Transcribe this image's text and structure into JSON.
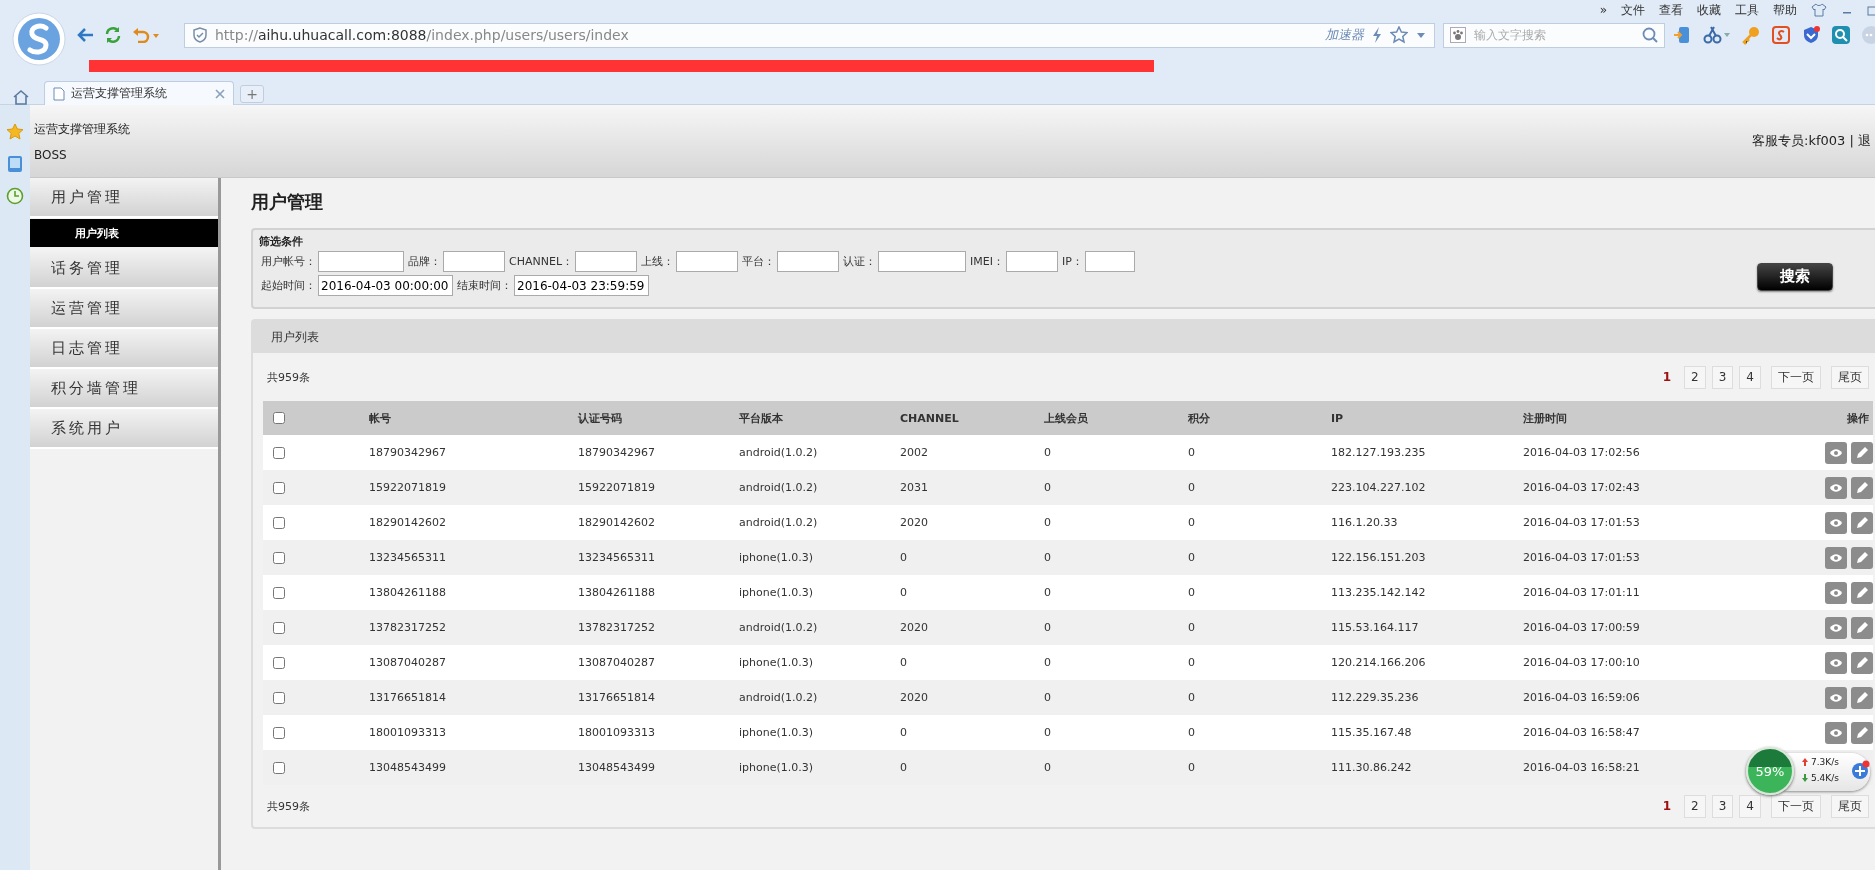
{
  "browser": {
    "menu": [
      "»",
      "文件",
      "查看",
      "收藏",
      "工具",
      "帮助"
    ],
    "url": {
      "scheme": "http://",
      "host": "aihu.uhuacall.com:8088",
      "path": "/index.php/users/users/index"
    },
    "accelerator": "加速器",
    "search_placeholder": "输入文字搜索",
    "tabs": [
      {
        "title": "运营支撑管理系统",
        "selected": true
      }
    ],
    "new_tab": "+"
  },
  "header": {
    "system_name": "运营支撑管理系统",
    "subtitle": "BOSS",
    "user_info": "客服专员:kf003 | 退"
  },
  "sidebar": {
    "items": [
      {
        "label": "用户管理",
        "children": [
          {
            "label": "用户列表",
            "selected": true
          }
        ]
      },
      {
        "label": "话务管理"
      },
      {
        "label": "运营管理"
      },
      {
        "label": "日志管理"
      },
      {
        "label": "积分墙管理"
      },
      {
        "label": "系统用户"
      }
    ]
  },
  "page_title": "用户管理",
  "filter": {
    "title": "筛选条件",
    "search_fields": [
      {
        "label": "用户帐号："
      },
      {
        "label": "品牌："
      },
      {
        "label": "CHANNEL："
      },
      {
        "label": "上线："
      },
      {
        "label": "平台："
      },
      {
        "label": "认证："
      },
      {
        "label": "IMEI："
      },
      {
        "label": "IP："
      }
    ],
    "time_fields": [
      {
        "label": "起始时间：",
        "value": "2016-04-03 00:00:00"
      },
      {
        "label": "结束时间：",
        "value": "2016-04-03 23:59:59"
      }
    ],
    "search_button": "搜索"
  },
  "user_list": {
    "title": "用户列表",
    "total": "共959条",
    "pagination": [
      {
        "label": "1",
        "selected": true
      },
      {
        "label": "2",
        "selected": false
      },
      {
        "label": "3",
        "selected": false
      },
      {
        "label": "4",
        "selected": false
      },
      {
        "label": "下一页",
        "selected": false
      },
      {
        "label": "尾页",
        "selected": false
      }
    ],
    "select_all_checked": false,
    "columns": [
      "帐号",
      "认证号码",
      "平台版本",
      "CHANNEL",
      "上线会员",
      "积分",
      "IP",
      "注册时间",
      "操作"
    ],
    "rows": [
      {
        "checked": false,
        "actions": true,
        "cells": [
          "18790342967",
          "18790342967",
          "android(1.0.2)",
          "2002",
          "0",
          "0",
          "182.127.193.235",
          "2016-04-03 17:02:56"
        ]
      },
      {
        "checked": false,
        "actions": true,
        "cells": [
          "15922071819",
          "15922071819",
          "android(1.0.2)",
          "2031",
          "0",
          "0",
          "223.104.227.102",
          "2016-04-03 17:02:43"
        ]
      },
      {
        "checked": false,
        "actions": true,
        "cells": [
          "18290142602",
          "18290142602",
          "android(1.0.2)",
          "2020",
          "0",
          "0",
          "116.1.20.33",
          "2016-04-03 17:01:53"
        ]
      },
      {
        "checked": false,
        "actions": true,
        "cells": [
          "13234565311",
          "13234565311",
          "iphone(1.0.3)",
          "0",
          "0",
          "0",
          "122.156.151.203",
          "2016-04-03 17:01:53"
        ]
      },
      {
        "checked": false,
        "actions": true,
        "cells": [
          "13804261188",
          "13804261188",
          "iphone(1.0.3)",
          "0",
          "0",
          "0",
          "113.235.142.142",
          "2016-04-03 17:01:11"
        ]
      },
      {
        "checked": false,
        "actions": true,
        "cells": [
          "13782317252",
          "13782317252",
          "android(1.0.2)",
          "2020",
          "0",
          "0",
          "115.53.164.117",
          "2016-04-03 17:00:59"
        ]
      },
      {
        "checked": false,
        "actions": true,
        "cells": [
          "13087040287",
          "13087040287",
          "iphone(1.0.3)",
          "0",
          "0",
          "0",
          "120.214.166.206",
          "2016-04-03 17:00:10"
        ]
      },
      {
        "checked": false,
        "actions": true,
        "cells": [
          "13176651814",
          "13176651814",
          "android(1.0.2)",
          "2020",
          "0",
          "0",
          "112.229.35.236",
          "2016-04-03 16:59:06"
        ]
      },
      {
        "checked": false,
        "actions": true,
        "cells": [
          "18001093313",
          "18001093313",
          "iphone(1.0.3)",
          "0",
          "0",
          "0",
          "115.35.167.48",
          "2016-04-03 16:58:47"
        ]
      },
      {
        "checked": false,
        "actions": false,
        "cells": [
          "13048543499",
          "13048543499",
          "iphone(1.0.3)",
          "0",
          "0",
          "0",
          "111.30.86.242",
          "2016-04-03 16:58:21"
        ]
      }
    ],
    "footer_total": "共959条",
    "footer_pagination": [
      {
        "label": "1",
        "selected": true
      },
      {
        "label": "2",
        "selected": false
      },
      {
        "label": "3",
        "selected": false
      },
      {
        "label": "4",
        "selected": false
      },
      {
        "label": "下一页",
        "selected": false
      },
      {
        "label": "尾页",
        "selected": false
      }
    ]
  },
  "net_widget": {
    "percent": "59%",
    "upload": "7.3K/s",
    "download": "5.4K/s"
  }
}
